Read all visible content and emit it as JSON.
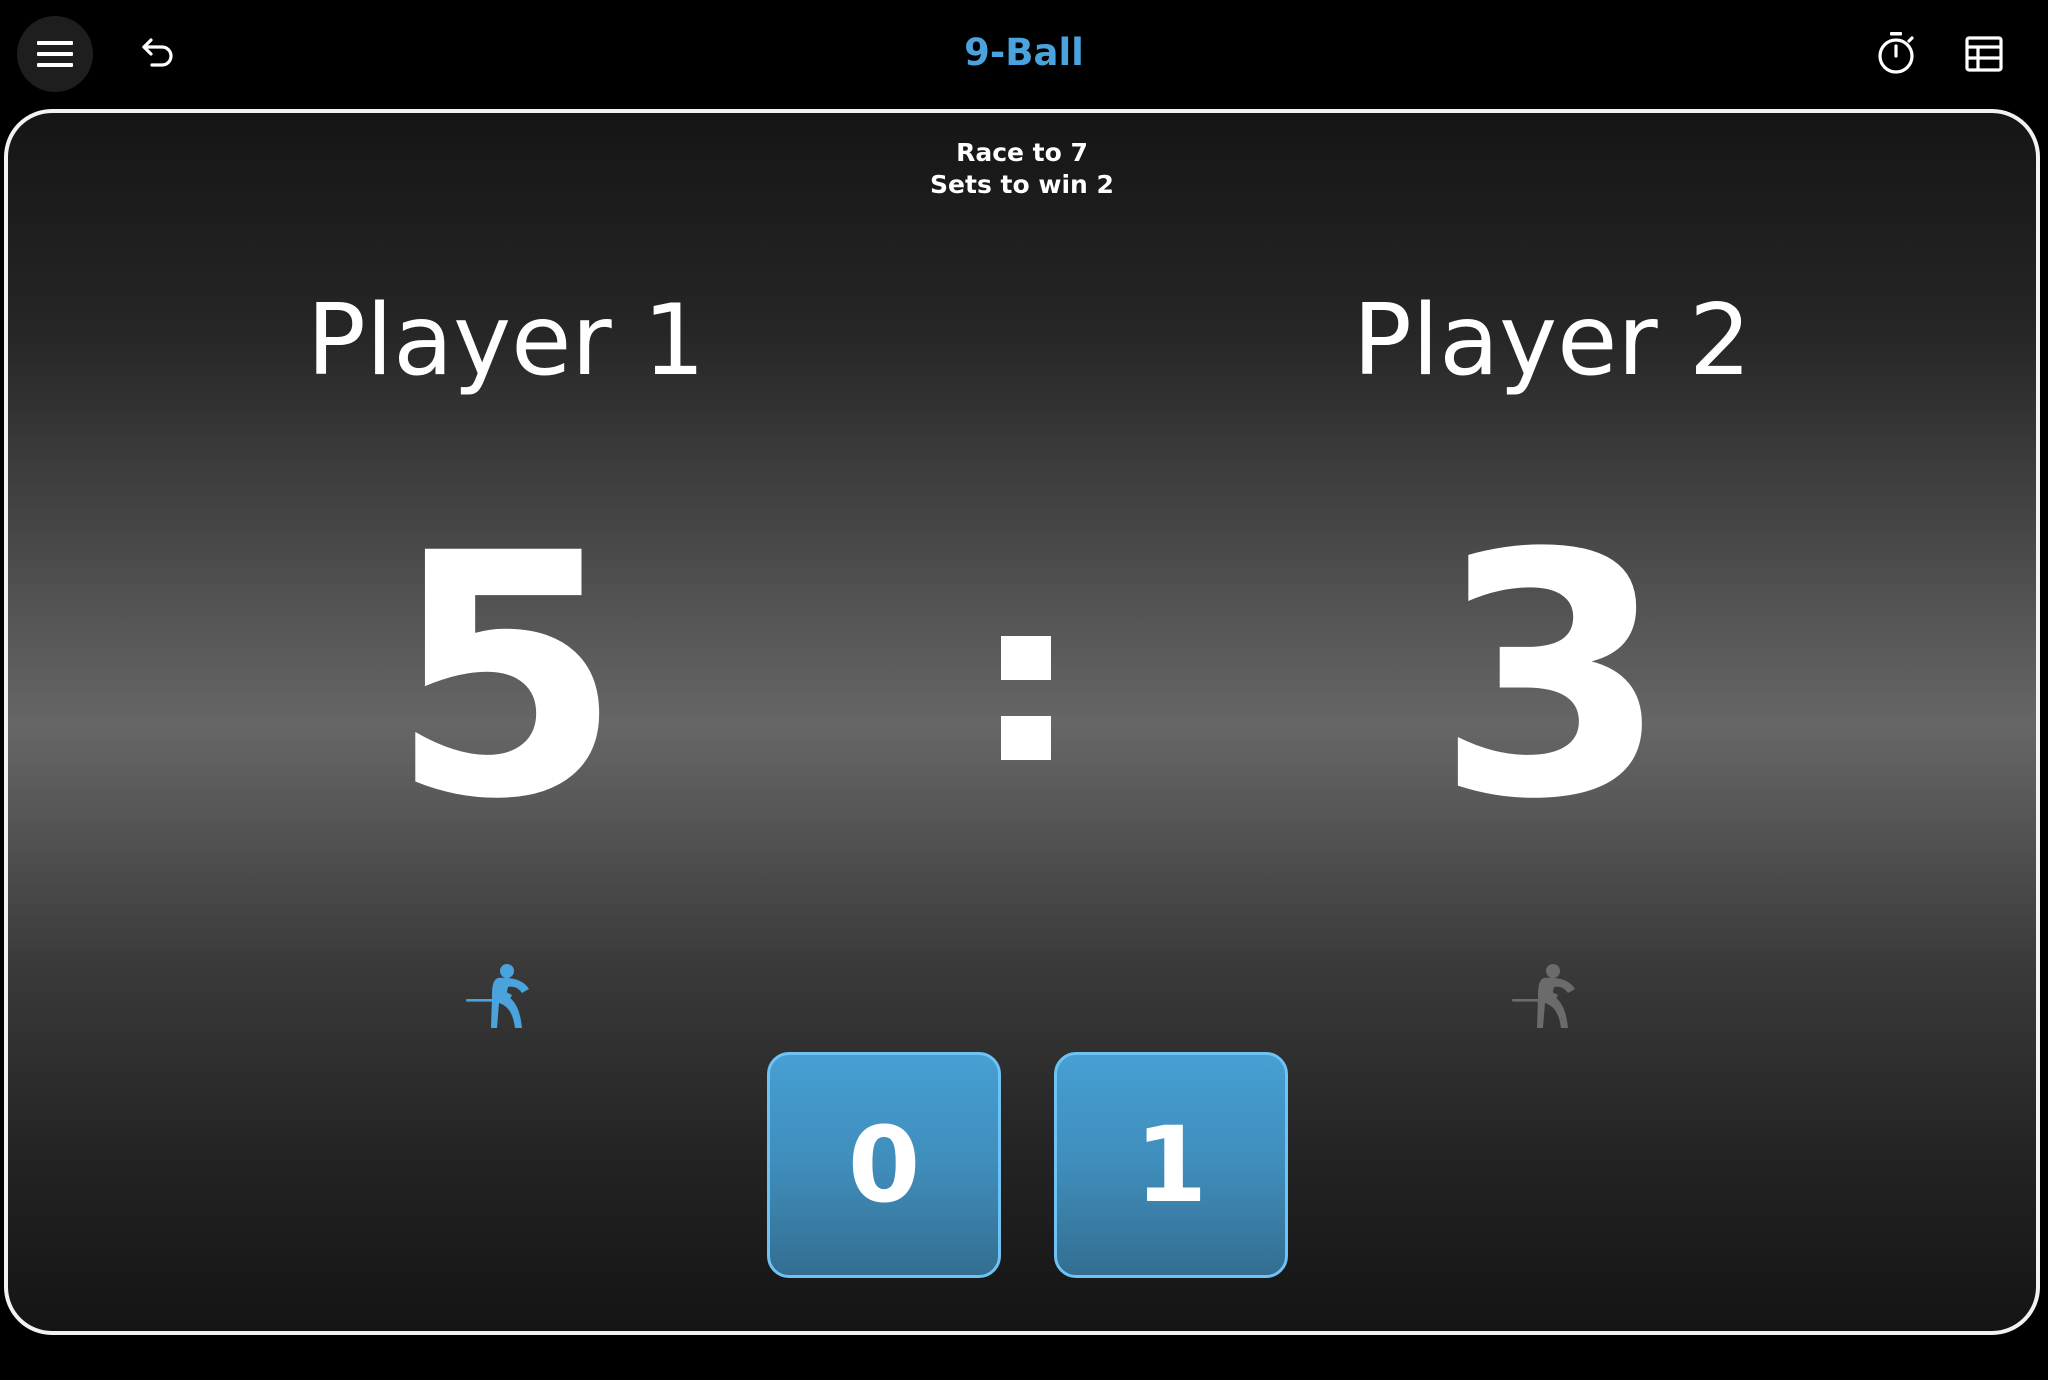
{
  "header": {
    "title": "9-Ball",
    "title_color": "#4aa3dc",
    "icons": {
      "menu": "hamburger-menu-icon",
      "undo": "undo-icon",
      "timer": "stopwatch-icon",
      "table": "table-grid-icon"
    }
  },
  "match": {
    "race_label": "Race to 7",
    "sets_label": "Sets to win 2"
  },
  "players": [
    {
      "name": "Player 1",
      "score": "5",
      "sets": "0",
      "is_shooting": true
    },
    {
      "name": "Player 2",
      "score": "3",
      "sets": "1",
      "is_shooting": false
    }
  ],
  "colors": {
    "accent": "#4aa3dc",
    "shooter_active": "#4aa3dc",
    "shooter_inactive": "#6b6b6b",
    "set_box_border": "#6fc2f4"
  }
}
